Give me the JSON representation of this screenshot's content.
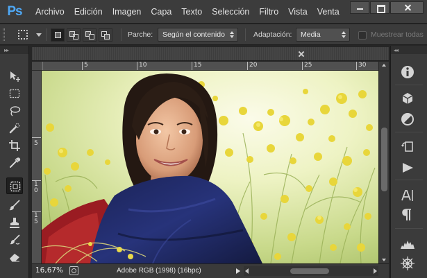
{
  "app": {
    "logo_text": "Ps"
  },
  "menu": {
    "items": [
      "Archivo",
      "Edición",
      "Imagen",
      "Capa",
      "Texto",
      "Selección",
      "Filtro",
      "Vista",
      "Venta"
    ]
  },
  "options_bar": {
    "patch_label": "Parche:",
    "patch_value": "Según el contenido",
    "adaptation_label": "Adaptación:",
    "adaptation_value": "Media",
    "sample_all_label": "Muestrear todas",
    "sample_all_checked": false
  },
  "toolbox": {
    "active_tool": "patch-tool",
    "tools": [
      "move-tool",
      "rectangular-marquee-tool",
      "lasso-tool",
      "quick-selection-tool",
      "crop-tool",
      "eyedropper-tool",
      "patch-tool",
      "brush-tool",
      "clone-stamp-tool",
      "history-brush-tool",
      "eraser-tool"
    ]
  },
  "ruler": {
    "top_labels": [
      "5",
      "10",
      "15",
      "20",
      "25",
      "30"
    ],
    "left_labels": [
      "5",
      "1\n0",
      "1\n5"
    ]
  },
  "status": {
    "zoom": "16,67%",
    "doc_info": "Adobe RGB (1998) (16bpc)"
  },
  "right_panel": {
    "icons": [
      "info-icon",
      "3d-icon",
      "color-icon",
      "history-icon",
      "actions-play-icon",
      "character-icon",
      "paragraph-icon",
      "histogram-icon",
      "navigator-icon"
    ]
  },
  "colors": {
    "accent": "#4fa8f5",
    "panel_bg": "#3b3b3b",
    "app_bg": "#262626"
  }
}
